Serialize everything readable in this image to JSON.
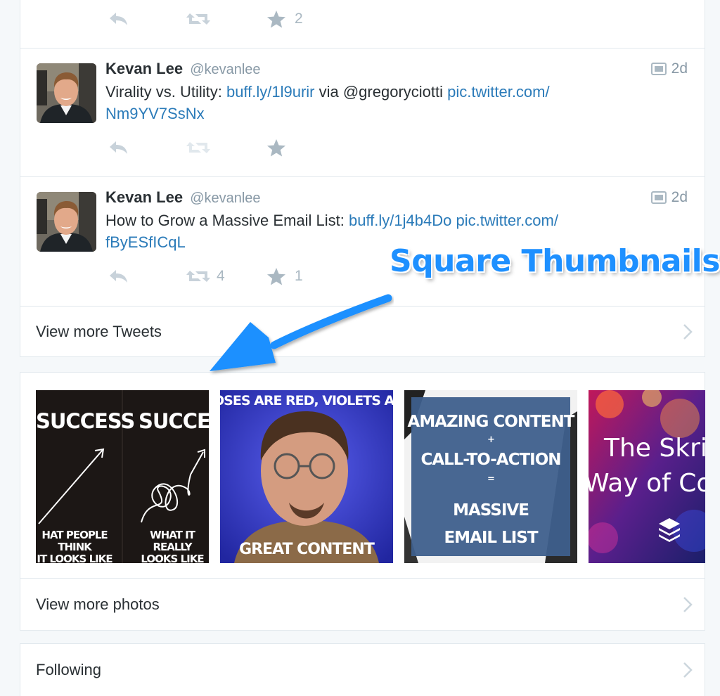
{
  "tweets": [
    {
      "fav_count": "2"
    },
    {
      "name": "Kevan Lee",
      "handle": "@kevanlee",
      "time": "2d",
      "text_1": "Virality vs. Utility: ",
      "link_1": "buff.ly/1l9urir",
      "text_2": " via @gregoryciotti ",
      "link_2": "pic.twitter.com/",
      "link_2b": "Nm9YV7SsNx"
    },
    {
      "name": "Kevan Lee",
      "handle": "@kevanlee",
      "time": "2d",
      "text_1": "How to Grow a Massive Email List: ",
      "link_1": "buff.ly/1j4b4Do",
      "text_2": " ",
      "link_2": "pic.twitter.com/",
      "link_2b": "fByESfICqL",
      "retweet_count": "4",
      "fav_count": "1"
    }
  ],
  "view_more_tweets": "View more Tweets",
  "view_more_photos": "View more photos",
  "following": "Following",
  "annotation": "Square Thumbnails",
  "photos": {
    "p1_left_title": "SUCCESS",
    "p1_right_title": "SUCCESS",
    "p1_left_caption_1": "HAT PEOPLE THINK",
    "p1_left_caption_2": "IT LOOKS LIKE",
    "p1_right_caption_1": "WHAT IT REALLY",
    "p1_right_caption_2": "LOOKS LIKE",
    "p2_top": "OSES ARE RED, VIOLETS ARE BLU",
    "p2_bottom": "GREAT CONTENT",
    "p3_line_1": "AMAZING CONTENT",
    "p3_plus": "+",
    "p3_line_2": "CALL-TO-ACTION",
    "p3_eq": "=",
    "p3_line_3": "MASSIVE",
    "p3_line_4": "EMAIL LIST",
    "p4_line_1": "The Skril",
    "p4_line_2": "Way of Con"
  },
  "colors": {
    "link": "#2b7bb9",
    "annotation": "#1e90ff",
    "action_icon": "#aab8c2"
  }
}
